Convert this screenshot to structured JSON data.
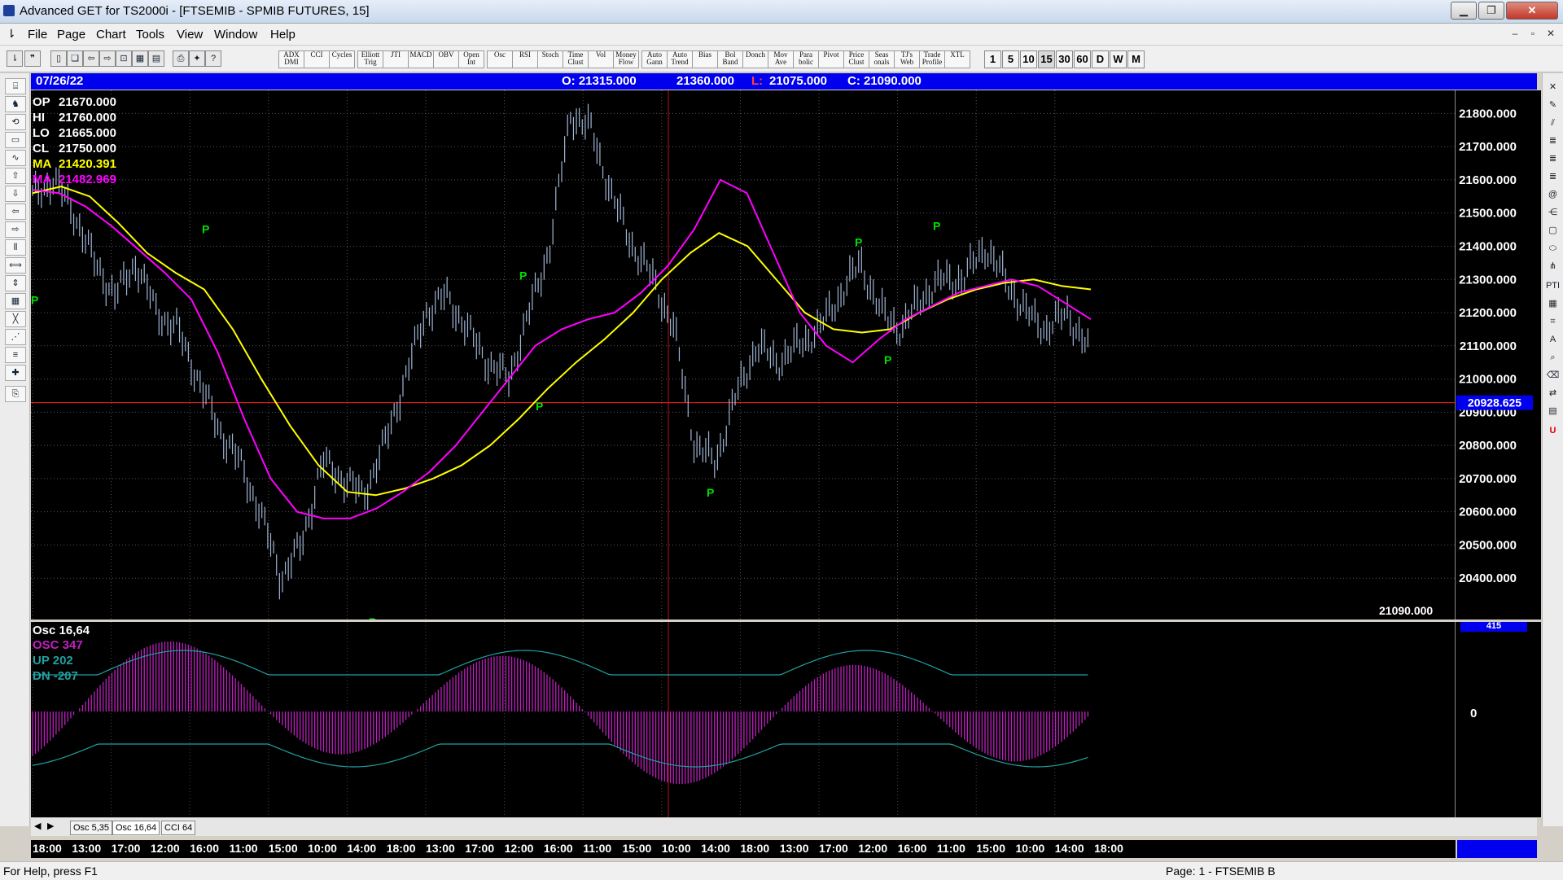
{
  "window": {
    "title": "Advanced GET for TS2000i - [FTSEMIB - SPMIB FUTURES, 15]",
    "controls": [
      "▁",
      "❐",
      "✕"
    ],
    "mdi_controls": [
      "–",
      "▫",
      "✕"
    ]
  },
  "menu": {
    "items": [
      "File",
      "Page",
      "Chart",
      "Tools",
      "View",
      "Window",
      "Help"
    ]
  },
  "toolbar": {
    "indicators": [
      "ADX DMI",
      "CCI",
      "Cycles",
      "Elliott Trig",
      "JTI",
      "MACD",
      "OBV",
      "Open Int",
      "Osc",
      "RSI",
      "Stoch",
      "Time Clust",
      "Vol",
      "Money Flow",
      "Auto Gann",
      "Auto Trend",
      "Bias",
      "Bol Band",
      "Donch",
      "Mov Ave",
      "Para bolic",
      "Pivot",
      "Price Clust",
      "Seas onals",
      "TJ's Web",
      "Trade Profile",
      "XTL"
    ],
    "timeframes": [
      "1",
      "5",
      "10",
      "15",
      "30",
      "60",
      "D",
      "W",
      "M"
    ]
  },
  "chart_header": {
    "date": "07/26/22",
    "open": "O: 21315.000",
    "high": "21360.000",
    "low_prefix": "L:",
    "low": "21075.000",
    "close": "C: 21090.000"
  },
  "price_legend": [
    {
      "label": "OP",
      "value": "21670.000",
      "color": "#ffffff"
    },
    {
      "label": "HI",
      "value": "21760.000",
      "color": "#ffffff"
    },
    {
      "label": "LO",
      "value": "21665.000",
      "color": "#ffffff"
    },
    {
      "label": "CL",
      "value": "21750.000",
      "color": "#ffffff"
    },
    {
      "label": "MA",
      "value": "21420.391",
      "color": "#ffff00"
    },
    {
      "label": "MA",
      "value": "21482.969",
      "color": "#ff00ff"
    }
  ],
  "price_axis": {
    "ticks": [
      "21800.000",
      "21700.000",
      "21600.000",
      "21500.000",
      "21400.000",
      "21300.000",
      "21200.000",
      "21100.000",
      "21000.000",
      "20900.000",
      "20800.000",
      "20700.000",
      "20600.000",
      "20500.000",
      "20400.000"
    ],
    "marker": "20928.625",
    "last_close": "21090.000"
  },
  "osc_legend": {
    "title": "Osc 16,64",
    "osc": "OSC 347",
    "up": "UP   202",
    "dn": "DN   -207",
    "zero": "0",
    "top": "415"
  },
  "pivot_label": "P",
  "tabs": [
    "Osc 5,35",
    "Osc 16,64",
    "CCI 64"
  ],
  "time_axis": [
    "18:00",
    "13:00",
    "17:00",
    "12:00",
    "16:00",
    "11:00",
    "15:00",
    "10:00",
    "14:00",
    "18:00",
    "13:00",
    "17:00",
    "12:00",
    "16:00",
    "11:00",
    "15:00",
    "10:00",
    "14:00",
    "18:00",
    "13:00",
    "17:00",
    "12:00",
    "16:00",
    "11:00",
    "15:00",
    "10:00",
    "14:00",
    "18:00"
  ],
  "status": {
    "help": "For Help, press F1",
    "page": "Page: 1 - FTSEMIB B"
  },
  "colors": {
    "ma_fast": "#ffff00",
    "ma_slow": "#ff00ff",
    "price_bars": "#9fb5d4",
    "pivot": "#00e000",
    "osc_hist": "#c020c0",
    "bands": "#20a0a0",
    "header_bg": "#0000ee",
    "marker_line": "#ff2020"
  },
  "chart_data": {
    "type": "line",
    "x_labels": [
      "18:00",
      "13:00",
      "17:00",
      "12:00",
      "16:00",
      "11:00",
      "15:00",
      "10:00",
      "14:00",
      "18:00",
      "13:00",
      "17:00",
      "12:00",
      "16:00",
      "11:00",
      "15:00",
      "10:00",
      "14:00",
      "18:00",
      "13:00",
      "17:00",
      "12:00",
      "16:00",
      "11:00",
      "15:00",
      "10:00",
      "14:00",
      "18:00"
    ],
    "series": [
      {
        "name": "Price",
        "values": [
          21550,
          21600,
          21500,
          21350,
          21250,
          21350,
          21200,
          21150,
          21000,
          20850,
          20750,
          20600,
          20400,
          20500,
          20750,
          20700,
          20650,
          20800,
          21000,
          21200,
          21250,
          21150,
          21050,
          21000,
          21200,
          21400,
          21800,
          21750,
          21550,
          21400,
          21300,
          21150,
          20800,
          20750,
          20950,
          21100,
          21050,
          21100,
          21150,
          21250,
          21350,
          21200,
          21150,
          21250,
          21300,
          21300,
          21400,
          21300,
          21200,
          21150,
          21200,
          21090
        ]
      },
      {
        "name": "MA",
        "values": [
          21560,
          21580,
          21550,
          21470,
          21380,
          21320,
          21270,
          21150,
          21000,
          20860,
          20740,
          20660,
          20650,
          20670,
          20700,
          20740,
          20800,
          20880,
          20970,
          21050,
          21120,
          21200,
          21300,
          21380,
          21440,
          21400,
          21300,
          21200,
          21150,
          21140,
          21150,
          21200,
          21240,
          21270,
          21290,
          21300,
          21280,
          21270
        ]
      },
      {
        "name": "MA",
        "values": [
          21570,
          21560,
          21520,
          21460,
          21390,
          21320,
          21240,
          21080,
          20880,
          20700,
          20600,
          20580,
          20580,
          20610,
          20660,
          20720,
          20800,
          20900,
          21000,
          21100,
          21150,
          21180,
          21200,
          21260,
          21340,
          21450,
          21600,
          21560,
          21380,
          21200,
          21100,
          21050,
          21120,
          21180,
          21220,
          21260,
          21280,
          21300,
          21280,
          21230,
          21180
        ]
      }
    ],
    "ylim": [
      20300,
      21850
    ],
    "pivots": [
      21280,
      21420,
      20310,
      21280,
      20960,
      21850,
      20700,
      21380,
      21100,
      21430
    ],
    "horizontal_line": 20928.625
  }
}
